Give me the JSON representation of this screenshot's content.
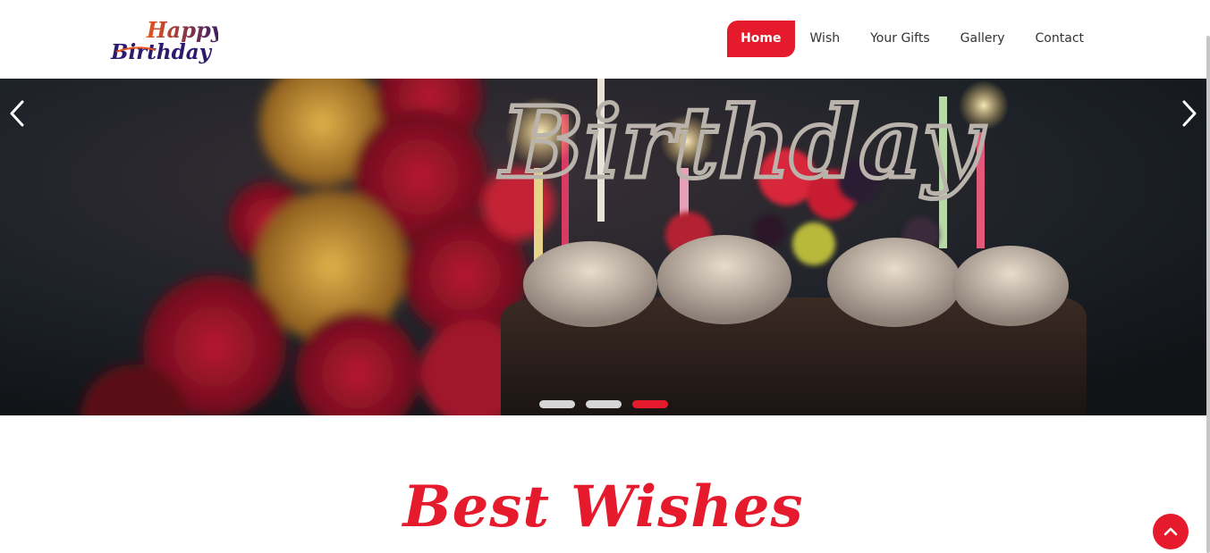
{
  "header": {
    "logo_line1": "Happy",
    "logo_line2": "Birthday",
    "nav": [
      {
        "label": "Home",
        "active": true
      },
      {
        "label": "Wish",
        "active": false
      },
      {
        "label": "Your Gifts",
        "active": false
      },
      {
        "label": "Gallery",
        "active": false
      },
      {
        "label": "Contact",
        "active": false
      }
    ]
  },
  "slider": {
    "prev_icon": "chevron-left-icon",
    "next_icon": "chevron-right-icon",
    "topper_text": "Birthday",
    "dots": [
      {
        "active": false
      },
      {
        "active": false
      },
      {
        "active": true
      }
    ]
  },
  "section": {
    "title": "Best Wishes"
  },
  "back_to_top": {
    "icon": "chevron-up-icon"
  },
  "colors": {
    "accent": "#e51a2c",
    "logo_purple": "#2d1a6e",
    "logo_orange": "#e8551c"
  }
}
